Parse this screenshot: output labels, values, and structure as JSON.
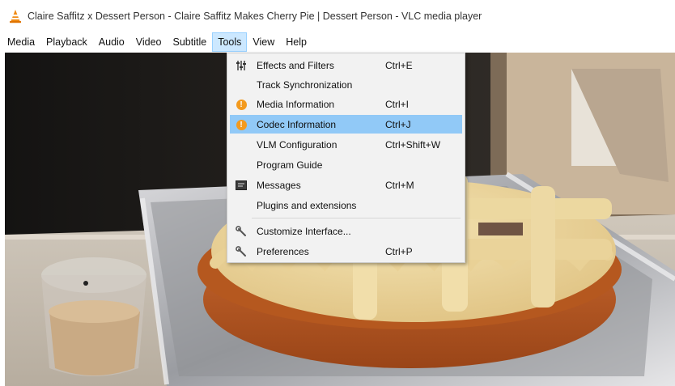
{
  "window": {
    "title": "Claire Saffitz x Dessert Person - Claire Saffitz Makes Cherry Pie | Dessert Person - VLC media player",
    "app_icon": "vlc-cone-icon"
  },
  "menubar": {
    "items": [
      {
        "label": "Media"
      },
      {
        "label": "Playback"
      },
      {
        "label": "Audio"
      },
      {
        "label": "Video"
      },
      {
        "label": "Subtitle"
      },
      {
        "label": "Tools",
        "active": true
      },
      {
        "label": "View"
      },
      {
        "label": "Help"
      }
    ]
  },
  "tools_menu": {
    "highlighted": "Codec Information",
    "items": [
      {
        "label": "Effects and Filters",
        "shortcut": "Ctrl+E",
        "icon": "sliders-icon"
      },
      {
        "label": "Track Synchronization",
        "shortcut": "",
        "icon": ""
      },
      {
        "label": "Media Information",
        "shortcut": "Ctrl+I",
        "icon": "info-icon"
      },
      {
        "label": "Codec Information",
        "shortcut": "Ctrl+J",
        "icon": "info-icon"
      },
      {
        "label": "VLM Configuration",
        "shortcut": "Ctrl+Shift+W",
        "icon": ""
      },
      {
        "label": "Program Guide",
        "shortcut": "",
        "icon": ""
      },
      {
        "label": "Messages",
        "shortcut": "Ctrl+M",
        "icon": "messages-icon"
      },
      {
        "label": "Plugins and extensions",
        "shortcut": "",
        "icon": ""
      },
      {
        "label": "Customize Interface...",
        "shortcut": "",
        "icon": "wrench-icon"
      },
      {
        "label": "Preferences",
        "shortcut": "Ctrl+P",
        "icon": "wrench-icon"
      }
    ]
  },
  "colors": {
    "menu_highlight": "#91c9f7",
    "menubar_active": "#cce8ff",
    "info_icon": "#f39a1e"
  }
}
